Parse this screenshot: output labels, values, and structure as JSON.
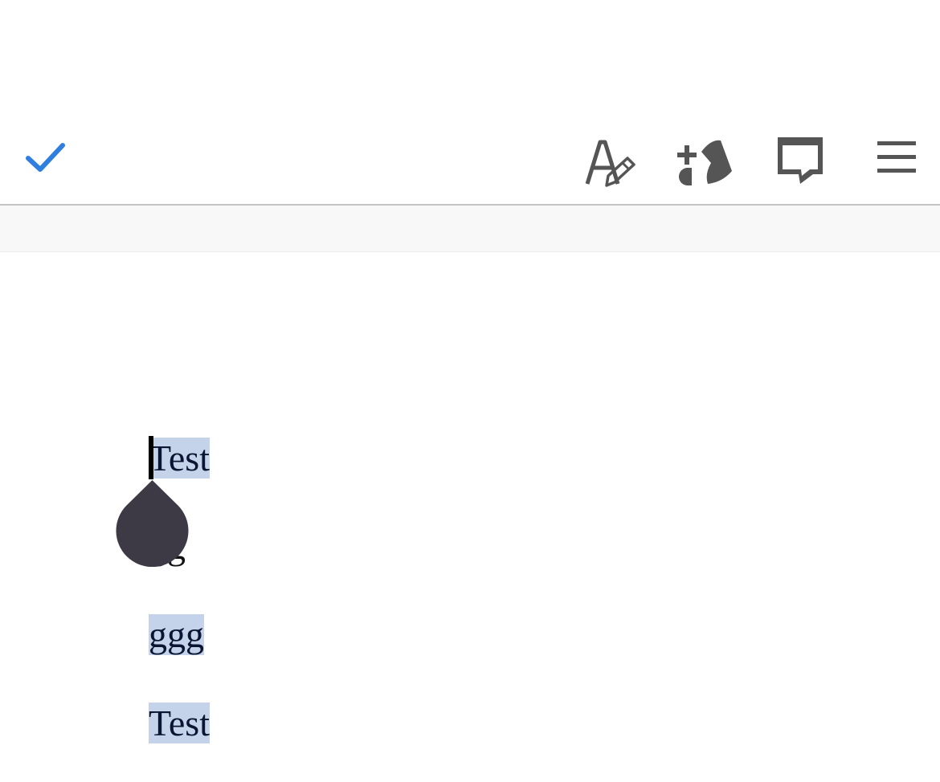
{
  "toolbar": {
    "done_icon": "checkmark-icon",
    "done_color": "#2f7fe0",
    "format_icon": "text-format-pencil-icon",
    "insert_icon": "insert-shapes-icon",
    "comment_icon": "comment-icon",
    "menu_icon": "hamburger-menu-icon",
    "icon_color": "#555555"
  },
  "document": {
    "paragraphs": [
      {
        "text": "Test",
        "selected": true
      },
      {
        "text": "gg",
        "selected": false,
        "misspelled": true
      },
      {
        "text": "ggg",
        "selected": true,
        "misspelled": true
      },
      {
        "text": "Test",
        "selected": true
      }
    ],
    "selection_color": "#c5d3ea",
    "handle_color": "#3d3a45"
  }
}
